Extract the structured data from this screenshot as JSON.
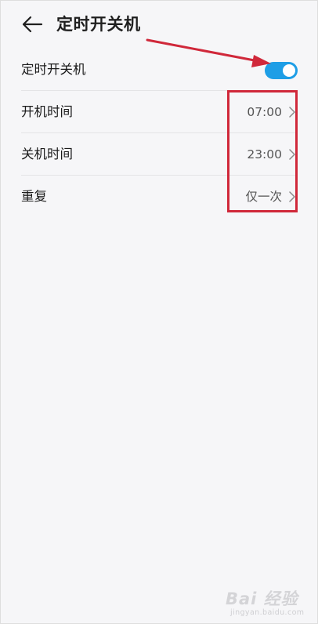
{
  "header": {
    "title": "定时开关机"
  },
  "settings": [
    {
      "label": "定时开关机",
      "type": "toggle",
      "enabled": true
    },
    {
      "label": "开机时间",
      "value": "07:00"
    },
    {
      "label": "关机时间",
      "value": "23:00"
    },
    {
      "label": "重复",
      "value": "仅一次"
    }
  ],
  "colors": {
    "toggle_on": "#1e9ee6",
    "annotation": "#d0283a"
  },
  "watermark": {
    "brand": "Bai 经验",
    "domain": "jingyan.baidu.com"
  }
}
